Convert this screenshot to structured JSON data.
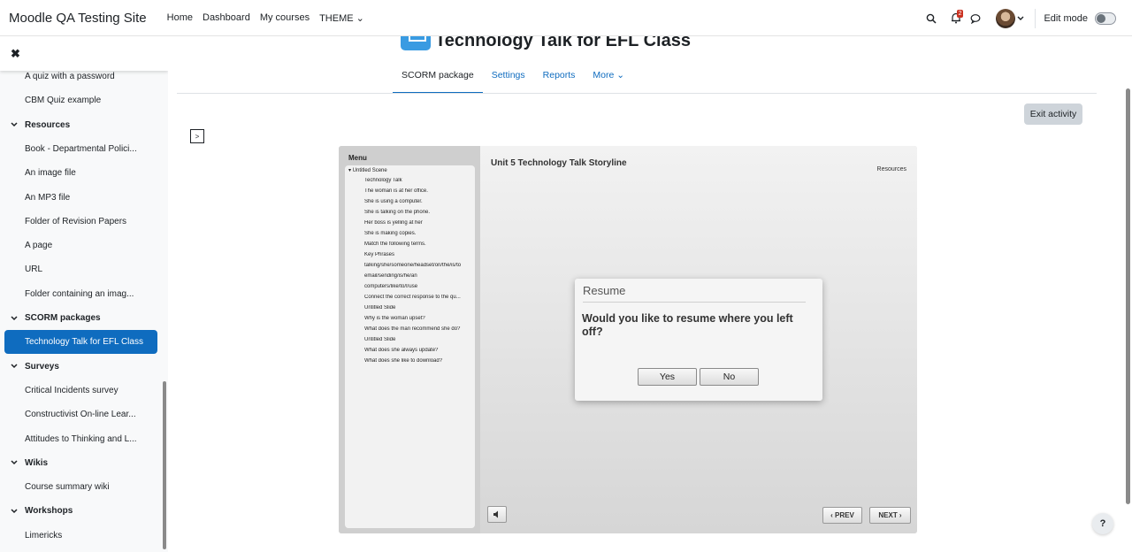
{
  "navbar": {
    "brand": "Moodle QA Testing Site",
    "links": [
      "Home",
      "Dashboard",
      "My courses",
      "THEME ⌄"
    ],
    "notification_count": "2",
    "edit_mode_label": "Edit mode"
  },
  "drawer": {
    "close_glyph": "✖",
    "items": [
      {
        "label": "A quiz with a password",
        "kind": "activity"
      },
      {
        "label": "CBM Quiz example",
        "kind": "activity"
      },
      {
        "label": "Resources",
        "kind": "section"
      },
      {
        "label": "Book - Departmental Polici...",
        "kind": "activity"
      },
      {
        "label": "An image file",
        "kind": "activity"
      },
      {
        "label": "An MP3 file",
        "kind": "activity"
      },
      {
        "label": "Folder of Revision Papers",
        "kind": "activity"
      },
      {
        "label": "A page",
        "kind": "activity"
      },
      {
        "label": "URL",
        "kind": "activity"
      },
      {
        "label": "Folder containing an imag...",
        "kind": "activity"
      },
      {
        "label": "SCORM packages",
        "kind": "section"
      },
      {
        "label": "Technology Talk for EFL Class",
        "kind": "active"
      },
      {
        "label": "Surveys",
        "kind": "section"
      },
      {
        "label": "Critical Incidents survey",
        "kind": "activity"
      },
      {
        "label": "Constructivist On-line Lear...",
        "kind": "activity"
      },
      {
        "label": "Attitudes to Thinking and L...",
        "kind": "activity"
      },
      {
        "label": "Wikis",
        "kind": "section"
      },
      {
        "label": "Course summary wiki",
        "kind": "activity"
      },
      {
        "label": "Workshops",
        "kind": "section"
      },
      {
        "label": "Limericks",
        "kind": "activity"
      }
    ]
  },
  "page": {
    "title": "Technology Talk for EFL Class",
    "tabs": [
      "SCORM package",
      "Settings",
      "Reports",
      "More ⌄"
    ],
    "exit_label": "Exit activity",
    "expand_glyph": ">"
  },
  "player": {
    "menu_title": "Menu",
    "scene": "▾ Untitled Scene",
    "menu_items": [
      "Technology Talk",
      "The woman is at her office.",
      "She is using a computer.",
      "She is talking on the phone.",
      "Her boss is yelling at her",
      "She is making copies.",
      "Match the following terms.",
      "Key Phrases",
      "talking/she/someone/headset/on/the/is/to",
      "email/sending/is/he/an",
      "computers/like/to/I/use",
      "Connect the correct response to the qu...",
      "Untitled Slide",
      "Why is the woman upset?",
      "What does the man recommend she do?",
      "Untitled Slide",
      "What does she always update?",
      "What does she like to download?"
    ],
    "slide_title": "Unit 5 Technology Talk Storyline",
    "resources_label": "Resources",
    "dialog": {
      "title": "Resume",
      "message": "Would you like to resume where you left off?",
      "yes": "Yes",
      "no": "No"
    },
    "prev_label": "‹ PREV",
    "next_label": "NEXT ›"
  },
  "help_label": "?"
}
